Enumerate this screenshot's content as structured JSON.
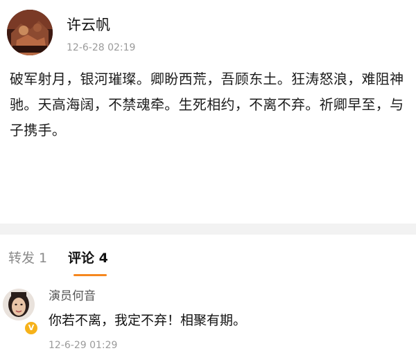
{
  "post": {
    "author": "许云帆",
    "time": "12-6-28 02:19",
    "body": "破军射月，银河璀璨。卿盼西荒，吾顾东土。狂涛怒浪，难阻神驰。天高海阔，不禁魂牵。生死相约，不离不弃。祈卿早至，与子携手。"
  },
  "tabs": {
    "repost_label": "转发 1",
    "comments_label": "评论 4",
    "active": "comments",
    "accent_color": "#f5871f"
  },
  "comment": {
    "author": "演员何音",
    "text": "你若不离，我定不弃！相聚有期。",
    "time": "12-6-29 01:29",
    "badge_icon": "verified-v-icon",
    "badge_text": "V",
    "badge_color": "#f6b21a"
  }
}
